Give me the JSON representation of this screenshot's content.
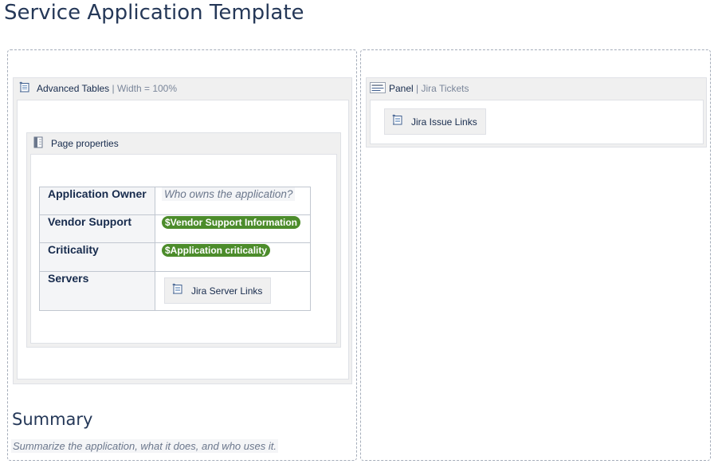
{
  "page": {
    "title": "Service Application Template"
  },
  "left_column": {
    "advanced_tables": {
      "name": "Advanced Tables",
      "separator": " | ",
      "param": "Width = 100%",
      "icon": "document-scroll-icon"
    },
    "page_properties": {
      "name": "Page properties",
      "icon": "page-properties-icon"
    },
    "properties_table": {
      "rows": [
        {
          "label": "Application Owner",
          "placeholder": "Who owns the application?"
        },
        {
          "label": "Vendor Support",
          "variable": "$Vendor Support Information"
        },
        {
          "label": "Criticality",
          "variable": "$Application criticality"
        },
        {
          "label": "Servers",
          "macro": "Jira Server Links"
        }
      ]
    },
    "summary": {
      "heading": "Summary",
      "placeholder": "Summarize the application, what it does, and who uses it."
    }
  },
  "right_column": {
    "panel": {
      "name": "Panel",
      "separator": " | ",
      "param": "Jira Tickets",
      "icon": "panel-lorem-icon"
    },
    "jira_issue_links": {
      "name": "Jira Issue Links",
      "icon": "document-scroll-icon"
    }
  },
  "colors": {
    "variable_badge": "#4c8c2b",
    "heading": "#253858",
    "macro_bg": "#f0f0f0"
  }
}
